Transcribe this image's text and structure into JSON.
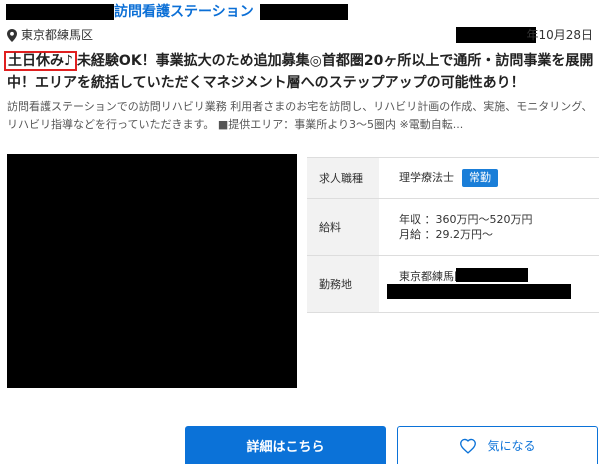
{
  "listing": {
    "title": "訪問看護ステーション",
    "location": "東京都練馬区",
    "date": "年10月28日",
    "tag": "土日休み♪",
    "headline": "未経験OK！事業拡大のため追加募集◎首都圏20ヶ所以上で通所・訪問事業を展開中！エリアを統括していただくマネジメント層へのステップアップの可能性あり！",
    "description": "訪問看護ステーションでの訪問リハビリ業務 利用者さまのお宅を訪問し、リハビリ計画の作成、実施、モニタリング、リハビリ指導などを行っていただきます。 ■提供エリア：事業所より3～5圏内 ※電動自転..."
  },
  "info": {
    "job_type_label": "求人職種",
    "job_type": "理学療法士",
    "employment_badge": "常勤",
    "salary_label": "給料",
    "salary_annual": "年収 ：360万円～520万円",
    "salary_monthly": "月給 ：29.2万円～",
    "workplace_label": "勤務地",
    "workplace": "東京都練馬区"
  },
  "actions": {
    "detail_label": "詳細はこちら",
    "favorite_label": "気になる"
  },
  "colors": {
    "link": "#0b6fd6",
    "primary": "#0b72d8",
    "tag_border": "#e02020",
    "badge": "#1a7ed8"
  }
}
